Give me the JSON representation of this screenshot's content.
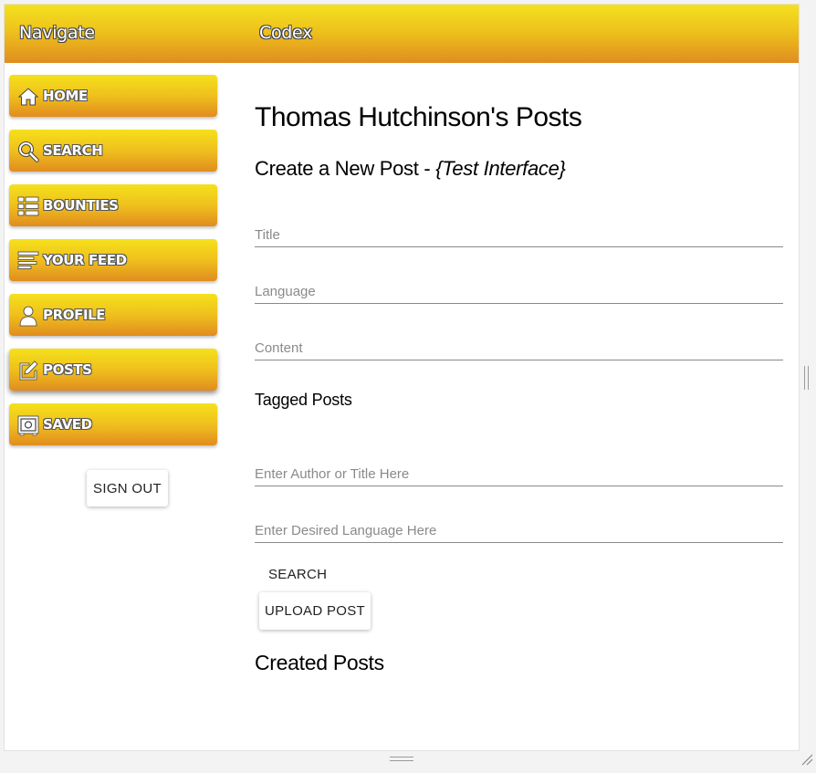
{
  "topbar": {
    "navigate": "Navigate",
    "app_name": "Codex"
  },
  "sidebar": {
    "items": [
      {
        "label": "HOME",
        "icon": "home-icon"
      },
      {
        "label": "SEARCH",
        "icon": "search-icon"
      },
      {
        "label": "BOUNTIES",
        "icon": "list-icon"
      },
      {
        "label": "YOUR FEED",
        "icon": "feed-icon"
      },
      {
        "label": "PROFILE",
        "icon": "person-icon"
      },
      {
        "label": "POSTS",
        "icon": "edit-icon",
        "active": true
      },
      {
        "label": "SAVED",
        "icon": "safe-icon"
      }
    ],
    "sign_out": "SIGN OUT"
  },
  "main": {
    "page_title": "Thomas Hutchinson's Posts",
    "create_heading": "Create a New Post - ",
    "create_heading_italic": "{Test Interface}",
    "title_placeholder": "Title",
    "language_placeholder": "Language",
    "content_placeholder": "Content",
    "tagged_heading": "Tagged Posts",
    "author_placeholder": "Enter Author or Title Here",
    "desired_language_placeholder": "Enter Desired Language Here",
    "search_label": "SEARCH",
    "upload_label": "UPLOAD POST",
    "created_heading": "Created Posts"
  },
  "colors": {
    "gradient_top": "#f4e11f",
    "gradient_bottom": "#e08d20",
    "text": "#000000",
    "placeholder": "#8a8a8a"
  }
}
